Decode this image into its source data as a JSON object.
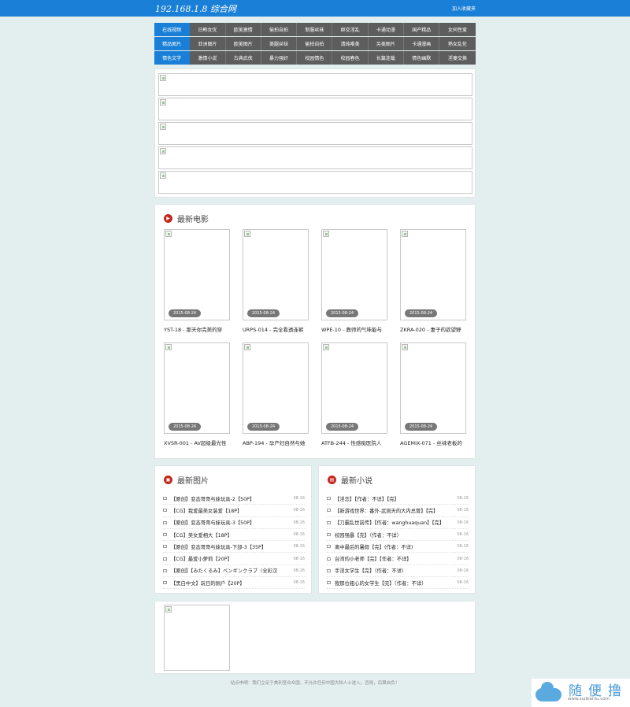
{
  "header": {
    "site_title": "192.168.1.8  综合网",
    "favorite_link": "加入收藏夹"
  },
  "nav": {
    "rows": [
      [
        "在线视频",
        "日韩女优",
        "欧美激情",
        "偷拍自拍",
        "制服丝袜",
        "群交淫乱",
        "卡通动漫",
        "国产精品",
        "女同性爱"
      ],
      [
        "精品图片",
        "亚洲图片",
        "欧美图片",
        "美腿丝袜",
        "偷拍自拍",
        "清纯唯美",
        "另类图片",
        "卡通漫画",
        "熟女乱伦"
      ],
      [
        "情色文学",
        "激情小说",
        "古典武侠",
        "暴力强奸",
        "校园情色",
        "校园春色",
        "长篇连载",
        "情色幽默",
        "淫妻交换"
      ]
    ]
  },
  "movies": {
    "heading": "最新电影",
    "items": [
      {
        "date": "2015-08-24",
        "title": "YST-18 - 那天你完美的穿"
      },
      {
        "date": "2015-08-24",
        "title": "URPS-014 - 完全看透连裤"
      },
      {
        "date": "2015-08-24",
        "title": "WPE-10 - 教师的气味能与"
      },
      {
        "date": "2015-08-24",
        "title": "ZKRA-020 - 妻子的欲望野"
      },
      {
        "date": "2015-08-24",
        "title": "XVSR-001 - AV超级最光性"
      },
      {
        "date": "2015-08-24",
        "title": "ABP-194 - 孕产妇自然与她"
      },
      {
        "date": "2015-08-24",
        "title": "ATFB-244 - 性感痴医院人"
      },
      {
        "date": "2015-08-24",
        "title": "AGEMIX-071 - 丝袜老板的"
      }
    ]
  },
  "pictures": {
    "heading": "最新图片",
    "items": [
      {
        "text": "【原创】变态哥哥与妹玩具-2【50P】",
        "date": "08-16"
      },
      {
        "text": "【CG】我爱最美女装爱【18P】",
        "date": "08-16"
      },
      {
        "text": "【原创】变态哥哥与妹玩具-3【50P】",
        "date": "08-16"
      },
      {
        "text": "【CG】美女爱相大【18P】",
        "date": "08-16"
      },
      {
        "text": "【原创】变态哥哥与妹玩具-下部-3【35P】",
        "date": "08-16"
      },
      {
        "text": "【CG】最爱小萝莉【20P】",
        "date": "08-16"
      },
      {
        "text": "【原创】【みたくるみ】ベンギンクラブ（全彩汉",
        "date": "08-16"
      },
      {
        "text": "【黑白中文】玩日的厕户【20P】",
        "date": "08-16"
      }
    ]
  },
  "novels": {
    "heading": "最新小说",
    "items": [
      {
        "text": "【淫恋】【作者：不详】【完】",
        "date": "08-16"
      },
      {
        "text": "【新游戏世界：番外-武则天的大内总管】【完】",
        "date": "08-16"
      },
      {
        "text": "【刀霸乱世前传】【作者：wanghuaquan】【完】",
        "date": "08-16"
      },
      {
        "text": "校园强暴【完】（作者：不详）",
        "date": "08-16"
      },
      {
        "text": "离中最后的暑假【完】(作者：不详)",
        "date": "08-16"
      },
      {
        "text": "台湾的小老师【完】【作者：不详】",
        "date": "08-16"
      },
      {
        "text": "手淫女学生【完】（作者：不详）",
        "date": "08-16"
      },
      {
        "text": "我那位粗心的女学生【完】（作者：不详）",
        "date": "08-16"
      }
    ]
  },
  "footer": {
    "notice": "站点申明：我们立足于美利坚合众国，不允许任何中国大陆人士进入，否则，后果自负！"
  },
  "watermark": {
    "text": "随便撸",
    "url": "www.suibianlu.com"
  },
  "colors": {
    "brand": "#1a7fd6",
    "nav_bg": "#5d5d5d",
    "icon_red": "#c4281c",
    "page_bg": "#e3efef"
  },
  "icons": {
    "movies": "play-icon",
    "pictures": "picture-icon",
    "novels": "book-icon"
  }
}
